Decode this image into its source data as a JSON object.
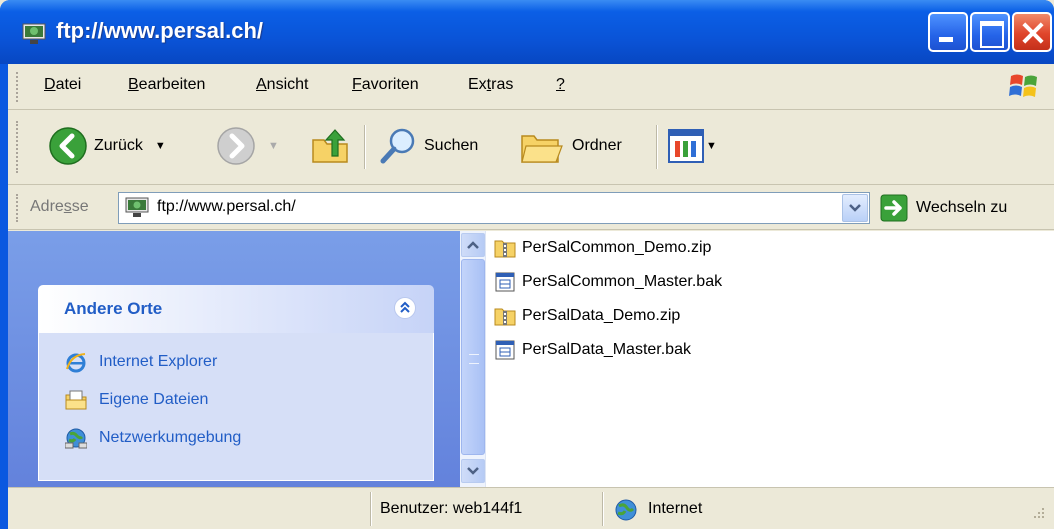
{
  "window": {
    "title": "ftp://www.persal.ch/",
    "title_icon": "ftp-folder-icon",
    "controls": [
      "minimize-icon",
      "maximize-icon",
      "close-icon"
    ]
  },
  "menu": {
    "items": [
      {
        "label": "Datei",
        "accel": "D",
        "rest": "atei"
      },
      {
        "label": "Bearbeiten",
        "accel": "B",
        "rest": "earbeiten"
      },
      {
        "label": "Ansicht",
        "accel": "A",
        "rest": "nsicht"
      },
      {
        "label": "Favoriten",
        "accel": "F",
        "rest": "avoriten"
      },
      {
        "label": "Extras",
        "pre": "Ex",
        "accel": "t",
        "rest": "ras"
      },
      {
        "label": "?",
        "accel": "?",
        "rest": ""
      }
    ]
  },
  "toolbar": {
    "back_label": "Zurück",
    "search_label": "Suchen",
    "folders_label": "Ordner"
  },
  "address": {
    "label_pre": "Adre",
    "label_accel": "s",
    "label_post": "se",
    "value": "ftp://www.persal.ch/",
    "go_label": "Wechseln zu"
  },
  "taskpane": {
    "title": "Andere Orte",
    "links": [
      {
        "label": "Internet Explorer",
        "icon": "internet-explorer-icon"
      },
      {
        "label": "Eigene Dateien",
        "icon": "my-documents-icon"
      },
      {
        "label": "Netzwerkumgebung",
        "icon": "network-places-icon"
      }
    ]
  },
  "files": [
    {
      "name": "PerSalCommon_Demo.zip",
      "icon": "zip-folder-icon"
    },
    {
      "name": "PerSalCommon_Master.bak",
      "icon": "bak-file-icon"
    },
    {
      "name": "PerSalData_Demo.zip",
      "icon": "zip-folder-icon"
    },
    {
      "name": "PerSalData_Master.bak",
      "icon": "bak-file-icon"
    }
  ],
  "status": {
    "user": "Benutzer: web144f1",
    "zone": "Internet"
  },
  "colors": {
    "titlebar": "#0a54d8",
    "link": "#215dc6",
    "taskpane": "#6f90e2"
  }
}
